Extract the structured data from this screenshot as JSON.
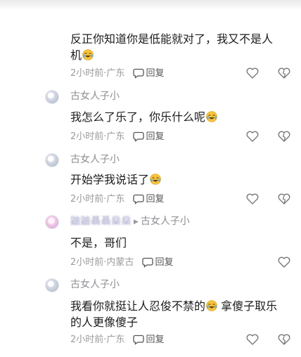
{
  "comments": [
    {
      "text": "反正你知道你是低能就对了，我又不是人机",
      "time": "2小时前",
      "location": "广东",
      "reply_label": "回复"
    },
    {
      "username": "古女人子小",
      "text": "我怎么了乐了，你乐什么呢",
      "time": "2小时前",
      "location": "广东",
      "reply_label": "回复"
    },
    {
      "username": "古女人子小",
      "text": "开始学我说话了",
      "time": "2小时前",
      "location": "广东",
      "reply_label": "回复"
    },
    {
      "username": "鼬鼬聶聶燊燊",
      "reply_to": "古女人子小",
      "text": "不是，哥们",
      "time": "2小时前",
      "location": "内蒙古",
      "reply_label": "回复"
    },
    {
      "username": "古女人子小",
      "text": "我看你就挺让人忍俊不禁的 拿傻子取乐的人更像傻子",
      "text_before_emoji": "我看你就挺让人忍俊不禁的",
      "text_after_emoji": "拿傻子取乐的人更像傻子",
      "time": "2小时前",
      "location": "广东",
      "reply_label": "回复"
    }
  ],
  "separator": "·",
  "icons": {
    "like": "heart-icon",
    "dislike": "broken-heart-icon",
    "reply": "speech-bubble-icon",
    "emoji": "laughing-crying-emoji-icon"
  },
  "colors": {
    "text": "#1c1c1c",
    "meta": "#9b9b9b",
    "emoji_face": "#f6c33c"
  }
}
